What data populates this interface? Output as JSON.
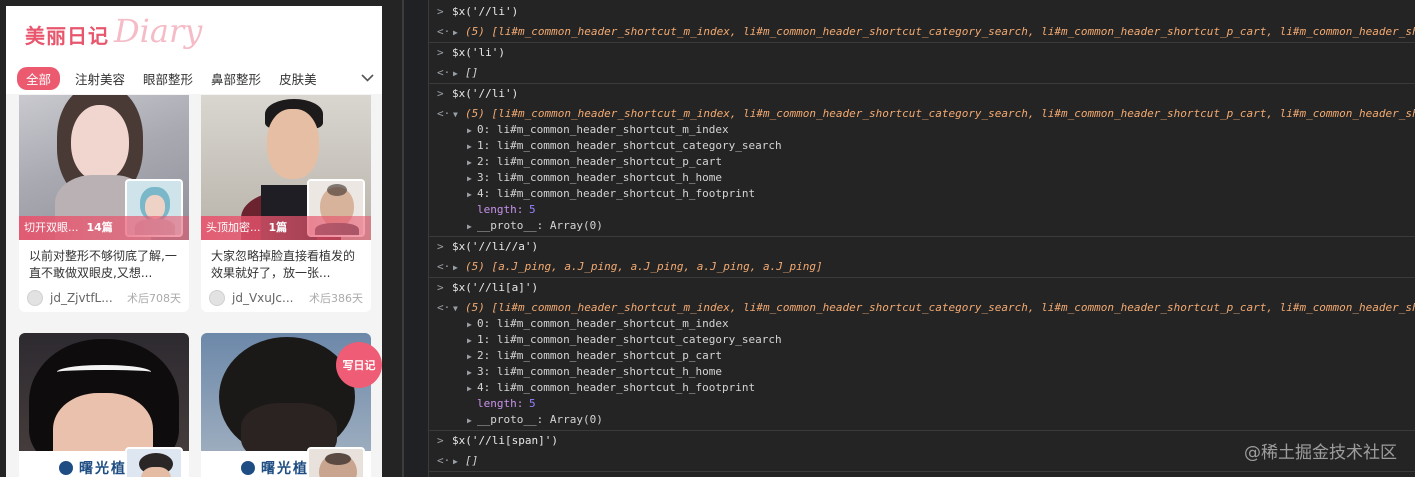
{
  "app": {
    "title": "美丽日记",
    "title_script": "Diary",
    "categories": [
      "全部",
      "注射美容",
      "眼部整形",
      "鼻部整形",
      "皮肤美"
    ],
    "cards": [
      {
        "tag": "切开双眼...",
        "count": "14篇",
        "text": "以前对整形不够彻底了解,一直不敢做双眼皮,又想...",
        "user": "jd_ZjvtfL...",
        "time": "术后708天"
      },
      {
        "tag": "头顶加密...",
        "count": "1篇",
        "text": "大家忽略掉脸直接看植发的效果就好了，放一张...",
        "user": "jd_VxuJc...",
        "time": "术后386天"
      },
      {
        "bottom_text": "曙光植"
      },
      {
        "bottom_text": "曙光植"
      }
    ],
    "write_button": "写日记"
  },
  "console": {
    "entries": [
      {
        "cmd": "$x('//li')",
        "result_collapsed": "(5) [li#m_common_header_shortcut_m_index, li#m_common_header_shortcut_category_search, li#m_common_header_shortcut_p_cart, li#m_common_header_sh"
      },
      {
        "cmd": "$x('li')",
        "result_collapsed": "[]"
      },
      {
        "cmd": "$x('//li')",
        "result_collapsed": "(5) [li#m_common_header_shortcut_m_index, li#m_common_header_shortcut_category_search, li#m_common_header_shortcut_p_cart, li#m_common_header_sh",
        "items": [
          "0: li#m_common_header_shortcut_m_index",
          "1: li#m_common_header_shortcut_category_search",
          "2: li#m_common_header_shortcut_p_cart",
          "3: li#m_common_header_shortcut_h_home",
          "4: li#m_common_header_shortcut_h_footprint"
        ],
        "length_label": "length:",
        "length_value": "5",
        "proto": "__proto__: Array(0)"
      },
      {
        "cmd": "$x('//li//a')",
        "result_collapsed": "(5) [a.J_ping, a.J_ping, a.J_ping, a.J_ping, a.J_ping]"
      },
      {
        "cmd": "$x('//li[a]')",
        "result_collapsed": "(5) [li#m_common_header_shortcut_m_index, li#m_common_header_shortcut_category_search, li#m_common_header_shortcut_p_cart, li#m_common_header_sh",
        "items": [
          "0: li#m_common_header_shortcut_m_index",
          "1: li#m_common_header_shortcut_category_search",
          "2: li#m_common_header_shortcut_p_cart",
          "3: li#m_common_header_shortcut_h_home",
          "4: li#m_common_header_shortcut_h_footprint"
        ],
        "length_label": "length:",
        "length_value": "5",
        "proto": "__proto__: Array(0)"
      },
      {
        "cmd": "$x('//li[span]')",
        "result_collapsed": "[]"
      }
    ]
  },
  "watermark": "@稀土掘金技术社区"
}
